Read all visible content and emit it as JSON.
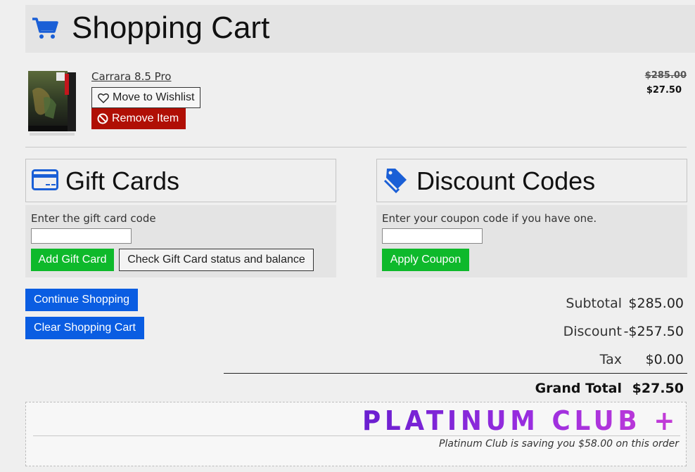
{
  "header": {
    "title": "Shopping Cart",
    "icon": "shopping-cart-icon",
    "icon_color": "#1a5fd6"
  },
  "cart_item": {
    "name": "Carrara 8.5 Pro",
    "original_price": "$285.00",
    "price": "$27.50",
    "wishlist_label": "Move to Wishlist",
    "remove_label": "Remove Item"
  },
  "gift_cards": {
    "title": "Gift Cards",
    "label": "Enter the gift card code",
    "input_value": "",
    "add_label": "Add Gift Card",
    "check_label": "Check Gift Card status and balance"
  },
  "discount_codes": {
    "title": "Discount Codes",
    "label": "Enter your coupon code if you have one.",
    "input_value": "",
    "apply_label": "Apply Coupon"
  },
  "actions": {
    "continue_label": "Continue Shopping",
    "clear_label": "Clear Shopping Cart"
  },
  "summary": {
    "subtotal_label": "Subtotal",
    "subtotal_value": "$285.00",
    "discount_label": "Discount",
    "discount_value": "-$257.50",
    "tax_label": "Tax",
    "tax_value": "$0.00",
    "total_label": "Grand Total",
    "total_value": "$27.50"
  },
  "platinum": {
    "logo_text": "PLATINUM CLUB +",
    "note": "Platinum Club is saving you $58.00 on this order"
  },
  "colors": {
    "accent_blue": "#0a5de2",
    "green": "#0eb92b",
    "remove_red": "#b00f05",
    "platinum_purple": "#8a2be2"
  }
}
